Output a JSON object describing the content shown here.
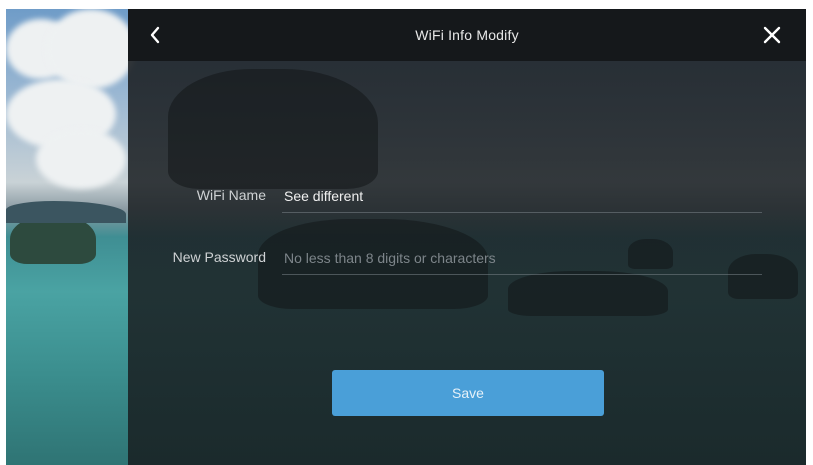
{
  "header": {
    "title": "WiFi Info Modify",
    "back_icon": "chevron-left-icon",
    "close_icon": "close-icon"
  },
  "form": {
    "wifi_name_label": "WiFi Name",
    "wifi_name_value": "See different",
    "password_label": "New Password",
    "password_placeholder": "No less than 8 digits or characters"
  },
  "actions": {
    "save_label": "Save"
  },
  "colors": {
    "accent": "#4a9fd8",
    "panel": "#1e2226",
    "topbar": "#15181b"
  }
}
